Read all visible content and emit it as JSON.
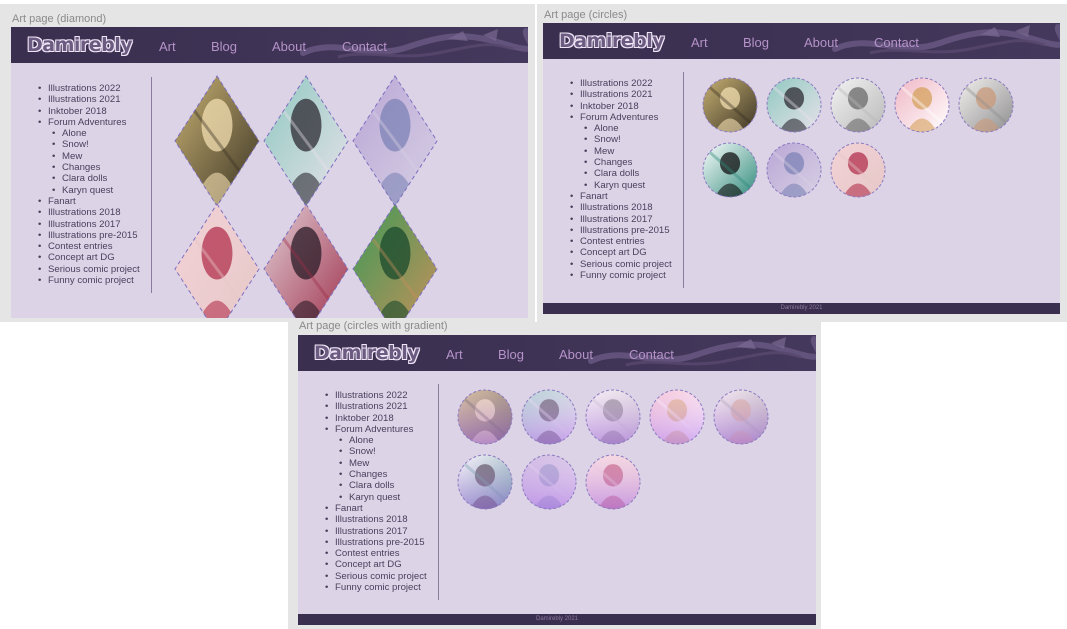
{
  "site": {
    "logo": "Damirebly",
    "nav": [
      "Art",
      "Blog",
      "About",
      "Contact"
    ],
    "footer": "Damirebly 2021",
    "sidebar": [
      {
        "label": "Illustrations 2022"
      },
      {
        "label": "Illustrations 2021"
      },
      {
        "label": "Inktober 2018"
      },
      {
        "label": "Forum Adventures",
        "children": [
          "Alone",
          "Snow!",
          "Mew",
          "Changes",
          "Clara dolls",
          "Karyn quest"
        ]
      },
      {
        "label": "Fanart"
      },
      {
        "label": "Illustrations  2018"
      },
      {
        "label": "Illustrations 2017"
      },
      {
        "label": "Illustrations pre-2015"
      },
      {
        "label": "Contest entries"
      },
      {
        "label": "Concept art DG"
      },
      {
        "label": "Serious comic project"
      },
      {
        "label": "Funny comic project"
      }
    ]
  },
  "frames": [
    {
      "label": "Art page (diamond)",
      "tile_shape": "diamond",
      "has_footer": false
    },
    {
      "label": "Art page (circles)",
      "tile_shape": "circle",
      "has_footer": true
    },
    {
      "label": "Art page (circles with gradient)",
      "tile_shape": "circle-gradient",
      "has_footer": true
    }
  ],
  "thumbnails": [
    {
      "name": "abstract-gold",
      "colors": [
        "#c9b274",
        "#f2deb0",
        "#3a3324"
      ]
    },
    {
      "name": "bunny-girl-teal",
      "colors": [
        "#8fc8c0",
        "#2d2a33",
        "#e8e2ea"
      ]
    },
    {
      "name": "grey-rabbit",
      "colors": [
        "#f4f4f4",
        "#6a6a6a",
        "#b8b8b8"
      ]
    },
    {
      "name": "pink-girl",
      "colors": [
        "#efb6c4",
        "#d6a05c",
        "#ffffff"
      ]
    },
    {
      "name": "rabbit-dressed",
      "colors": [
        "#f4f0f0",
        "#c99a7a",
        "#8e8e8e"
      ]
    },
    {
      "name": "dark-creatures",
      "colors": [
        "#ffffff",
        "#121212",
        "#2e8a7a"
      ]
    },
    {
      "name": "purple-figure",
      "colors": [
        "#b9a6d6",
        "#7c83b6",
        "#d8d0e4"
      ]
    },
    {
      "name": "red-haired-girl",
      "colors": [
        "#f2d2d6",
        "#b2304d",
        "#e7c8c8"
      ]
    },
    {
      "name": "dark-haired-girl",
      "colors": [
        "#e2d0d8",
        "#2a1b26",
        "#9e2f4a"
      ]
    },
    {
      "name": "green-girl",
      "colors": [
        "#3c9a58",
        "#1a4a2c",
        "#c9905a"
      ]
    }
  ]
}
